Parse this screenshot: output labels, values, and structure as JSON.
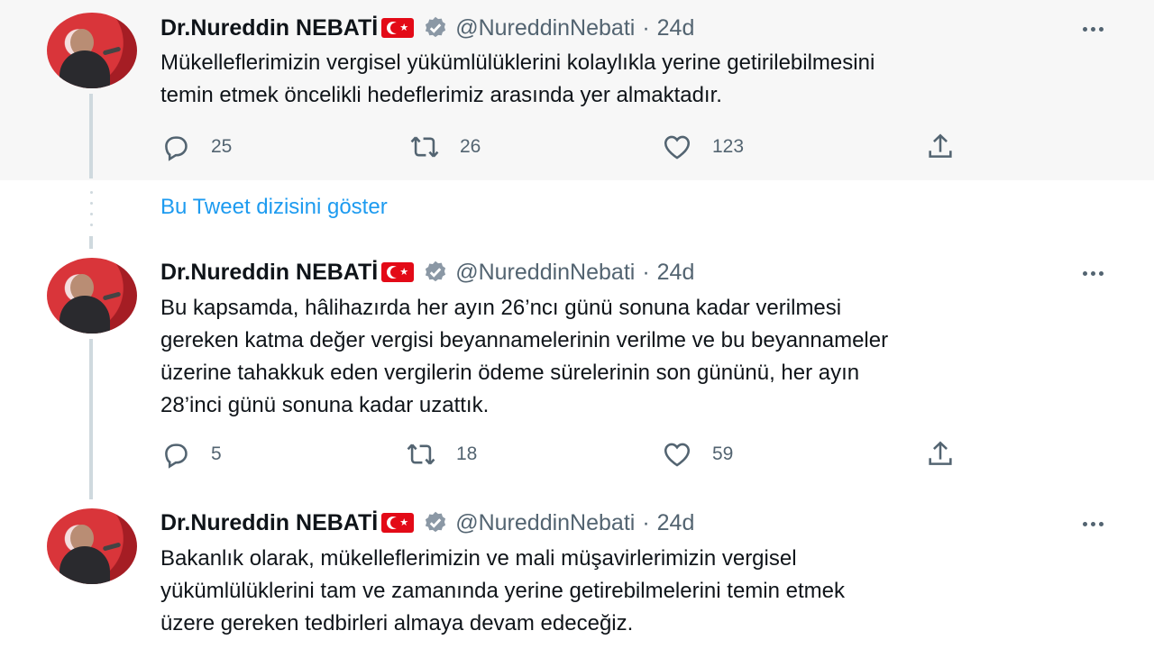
{
  "accent_color": "#1d9bf0",
  "show_thread_label": "Bu Tweet dizisini göster",
  "tweets": [
    {
      "name": "Dr.Nureddin NEBATİ",
      "handle": "@NureddinNebati",
      "separator": "·",
      "time": "24d",
      "lines": [
        "Mükelleflerimizin vergisel yükümlülüklerini kolaylıkla yerine getirilebilmesini",
        "temin etmek öncelikli hedeflerimiz arasında yer almaktadır."
      ],
      "replies": "25",
      "retweets": "26",
      "likes": "123"
    },
    {
      "name": "Dr.Nureddin NEBATİ",
      "handle": "@NureddinNebati",
      "separator": "·",
      "time": "24d",
      "lines": [
        "Bu kapsamda, hâlihazırda her ayın 26’ncı günü sonuna kadar verilmesi",
        "gereken katma değer vergisi beyannamelerinin verilme ve bu beyannameler",
        "üzerine tahakkuk eden vergilerin ödeme sürelerinin son gününü, her ayın",
        "28’inci günü sonuna kadar uzattık."
      ],
      "replies": "5",
      "retweets": "18",
      "likes": "59"
    },
    {
      "name": "Dr.Nureddin NEBATİ",
      "handle": "@NureddinNebati",
      "separator": "·",
      "time": "24d",
      "lines": [
        "Bakanlık olarak, mükelleflerimizin ve mali müşavirlerimizin vergisel",
        "yükümlülüklerini tam ve zamanında yerine getirebilmelerini temin etmek",
        "üzere gereken tedbirleri almaya devam edeceğiz."
      ]
    }
  ]
}
